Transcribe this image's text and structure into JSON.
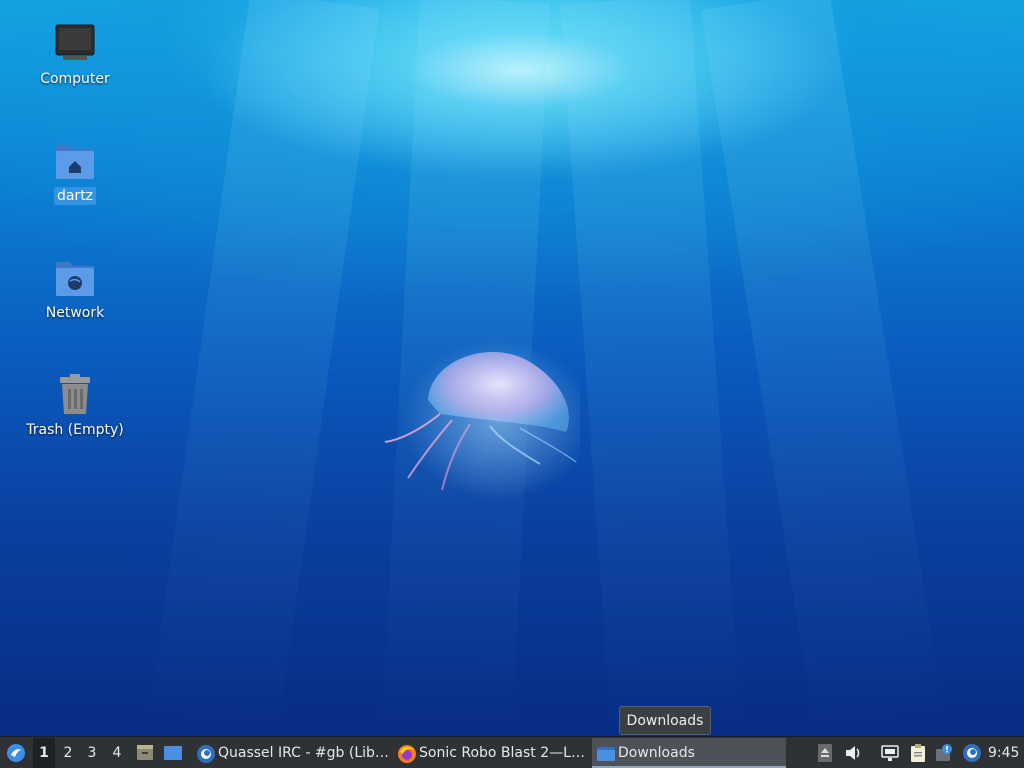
{
  "desktop": {
    "icons": [
      {
        "label": "Computer",
        "icon": "computer-icon"
      },
      {
        "label": "dartz",
        "icon": "home-folder-icon"
      },
      {
        "label": "Network",
        "icon": "network-folder-icon"
      },
      {
        "label": "Trash (Empty)",
        "icon": "trash-icon"
      }
    ]
  },
  "tooltip": {
    "text": "Downloads"
  },
  "taskbar": {
    "start_icon": "lubuntu-menu-icon",
    "workspaces": [
      "1",
      "2",
      "3",
      "4"
    ],
    "active_workspace": "1",
    "quicklaunch": [
      {
        "icon": "file-manager-icon"
      },
      {
        "icon": "show-desktop-icon"
      }
    ],
    "tasks": [
      {
        "label": "Quassel IRC - #gb (Lib…",
        "icon": "quassel-icon"
      },
      {
        "label": "Sonic Robo Blast 2—L…",
        "icon": "firefox-icon"
      },
      {
        "label": "Downloads",
        "icon": "folder-window-icon",
        "active": true
      }
    ],
    "tray": [
      {
        "icon": "eject-icon"
      },
      {
        "icon": "volume-icon"
      },
      {
        "icon": "network-wired-icon"
      },
      {
        "icon": "clipboard-icon"
      },
      {
        "icon": "update-notifier-icon"
      },
      {
        "icon": "lubuntu-update-icon"
      }
    ],
    "clock": "9:45"
  },
  "colors": {
    "taskbar_bg": "#2f3235",
    "active_task_bg": "#4c5257",
    "selection": "#3c96e6"
  }
}
